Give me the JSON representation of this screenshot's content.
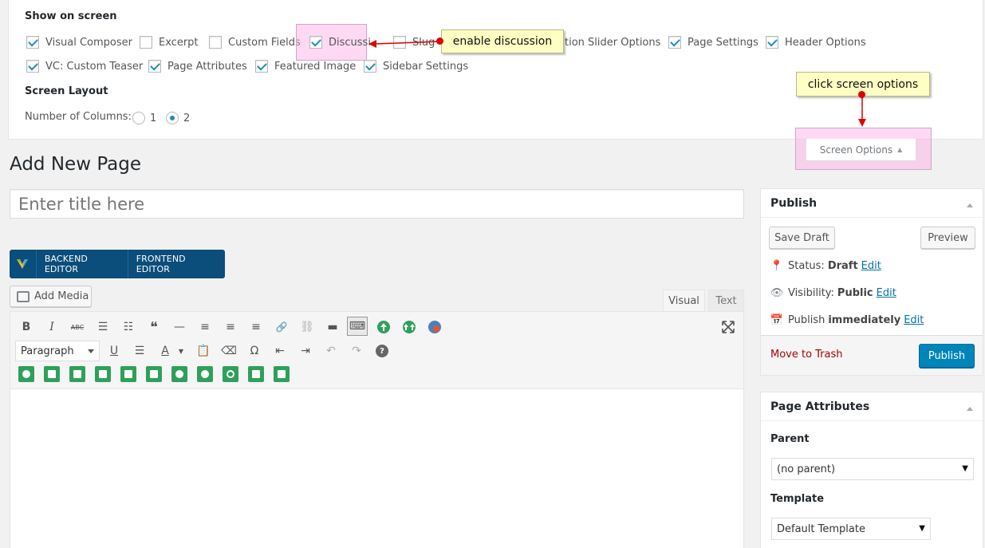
{
  "screen_options": {
    "heading_show": "Show on screen",
    "checkboxes": [
      {
        "label": "Visual Composer",
        "checked": true
      },
      {
        "label": "Excerpt",
        "checked": false
      },
      {
        "label": "Custom Fields",
        "checked": false
      },
      {
        "label": "Discussi",
        "checked": true
      },
      {
        "label": "Slug",
        "checked": false
      },
      {
        "label": "tion Slider Options",
        "checked": null
      },
      {
        "label": "Page Settings",
        "checked": true
      },
      {
        "label": "Header Options",
        "checked": true
      },
      {
        "label": "VC: Custom Teaser",
        "checked": true
      },
      {
        "label": "Page Attributes",
        "checked": true
      },
      {
        "label": "Featured Image",
        "checked": true
      },
      {
        "label": "Sidebar Settings",
        "checked": true
      }
    ],
    "heading_layout": "Screen Layout",
    "columns_label": "Number of Columns:",
    "column_options": [
      {
        "label": "1",
        "checked": false
      },
      {
        "label": "2",
        "checked": true
      }
    ]
  },
  "annotations": {
    "enable_discussion": "enable discussion",
    "click_screen_options": "click screen options"
  },
  "screen_options_tab": {
    "label": "Screen Options",
    "icon": "triangle-up-icon"
  },
  "page": {
    "title": "Add New Page",
    "title_placeholder": "Enter title here"
  },
  "vc": {
    "backend": "BACKEND EDITOR",
    "frontend": "FRONTEND EDITOR"
  },
  "editor": {
    "add_media": "Add Media",
    "tab_visual": "Visual",
    "tab_text": "Text",
    "format_select": "Paragraph",
    "row1_icons": [
      "bold-icon",
      "italic-icon",
      "strikethrough-icon",
      "bullet-list-icon",
      "numbered-list-icon",
      "blockquote-icon",
      "horizontal-rule-icon",
      "align-left-icon",
      "align-center-icon",
      "align-right-icon",
      "link-icon",
      "unlink-icon",
      "read-more-icon",
      "toolbar-toggle-icon",
      "plugin-upload-icon",
      "plugin-upload-multi-icon",
      "plugin-globe-icon"
    ],
    "row1_glyphs": [
      "B",
      "I",
      "ABC",
      "☰",
      "☷",
      "❝",
      "—",
      "≡",
      "≡",
      "≡",
      "🔗",
      "⛓",
      "▬",
      "⌨",
      "",
      "",
      ""
    ],
    "row2_glyphs": [
      "U",
      "☰",
      "A",
      "📋",
      "⌫",
      "Ω",
      "⇤",
      "⇥",
      "↶",
      "↷",
      "?"
    ],
    "fullscreen_icon": "fullscreen-icon"
  },
  "publish": {
    "title": "Publish",
    "save_draft": "Save Draft",
    "preview": "Preview",
    "status_label": "Status:",
    "status_value": "Draft",
    "visibility_label": "Visibility:",
    "visibility_value": "Public",
    "publish_label": "Publish",
    "publish_value": "immediately",
    "edit": "Edit",
    "move_to_trash": "Move to Trash",
    "publish_button": "Publish"
  },
  "page_attributes": {
    "title": "Page Attributes",
    "parent_label": "Parent",
    "parent_value": "(no parent)",
    "template_label": "Template",
    "template_value": "Default Template"
  },
  "colors": {
    "accent": "#0085ba",
    "link": "#0073aa",
    "trash": "#a00",
    "vc_bar": "#0b4d7b",
    "plugin_green": "#2fa05a"
  }
}
